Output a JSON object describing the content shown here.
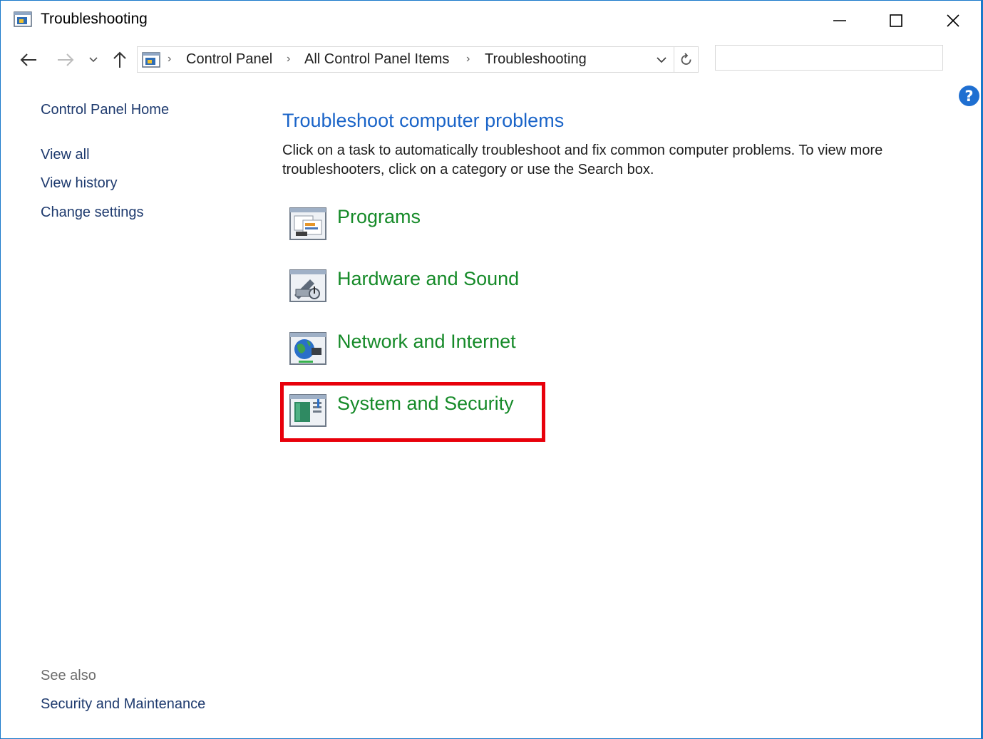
{
  "window": {
    "title": "Troubleshooting",
    "minimize_icon": "minimize-icon",
    "maximize_icon": "maximize-icon",
    "close_icon": "close-icon"
  },
  "nav": {
    "breadcrumbs": [
      {
        "label": "Control Panel"
      },
      {
        "label": "All Control Panel Items"
      },
      {
        "label": "Troubleshooting"
      }
    ],
    "search_placeholder": "",
    "search_value": ""
  },
  "sidebar": {
    "home": "Control Panel Home",
    "items": [
      {
        "label": "View all"
      },
      {
        "label": "View history"
      },
      {
        "label": "Change settings"
      }
    ],
    "see_also_heading": "See also",
    "see_also_items": [
      {
        "label": "Security and Maintenance"
      }
    ]
  },
  "main": {
    "title": "Troubleshoot computer problems",
    "description": "Click on a task to automatically troubleshoot and fix common computer problems. To view more troubleshooters, click on a category or use the Search box.",
    "categories": [
      {
        "label": "Programs",
        "icon": "programs-icon"
      },
      {
        "label": "Hardware and Sound",
        "icon": "hardware-sound-icon"
      },
      {
        "label": "Network and Internet",
        "icon": "network-internet-icon"
      },
      {
        "label": "System and Security",
        "icon": "system-security-icon"
      }
    ]
  },
  "help": {
    "label": "?"
  },
  "colors": {
    "window_border": "#1979ca",
    "link_dark": "#1e3a6e",
    "heading_blue": "#1a64c8",
    "category_green": "#158a28",
    "highlight_red": "#e8000b"
  }
}
